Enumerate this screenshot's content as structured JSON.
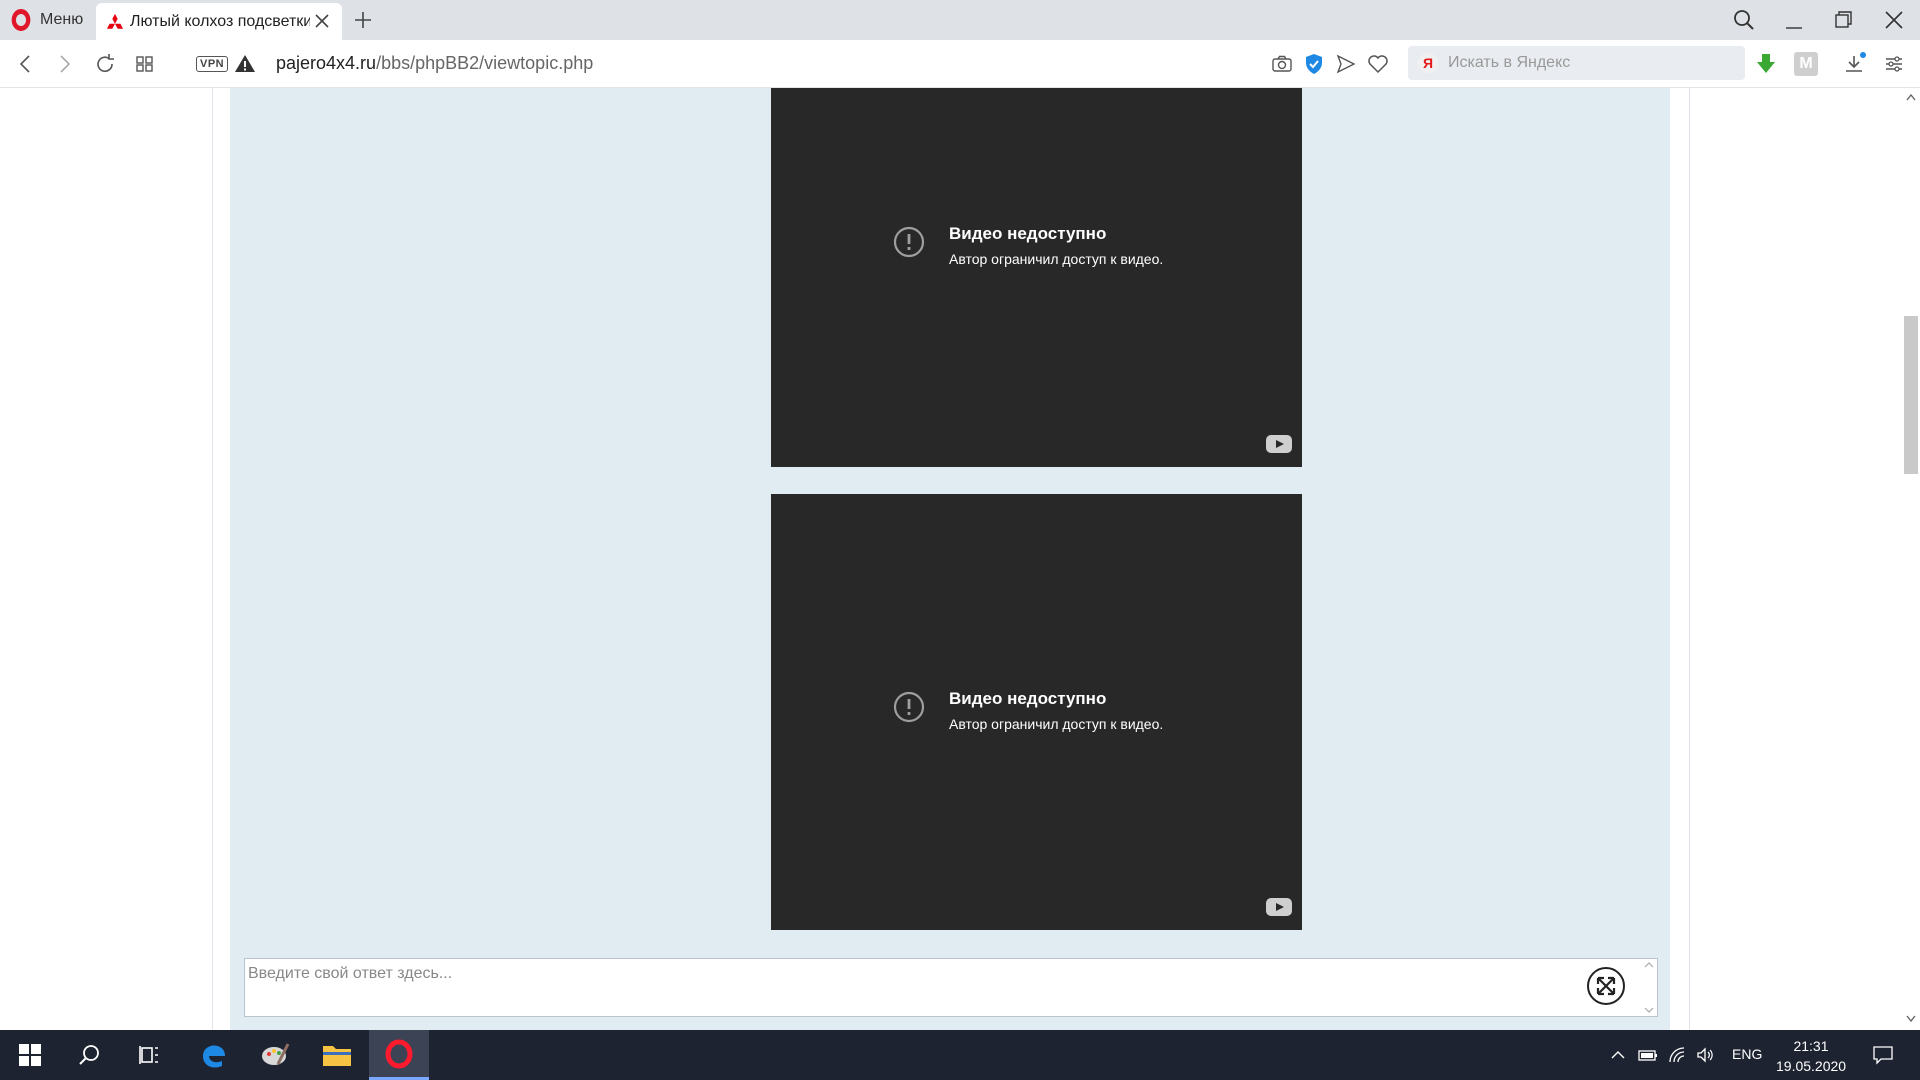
{
  "browser": {
    "menu_label": "Меню",
    "active_tab_title": "Лютый колхоз подсветки",
    "url_host": "pajero4x4.ru",
    "url_path": "/bbs/phpBB2/viewtopic.php",
    "vpn_label": "VPN",
    "search_placeholder": "Искать в Яндекс",
    "search_engine_glyph": "Я",
    "m_extension_label": "M"
  },
  "page": {
    "videos": [
      {
        "title": "Видео недоступно",
        "subtitle": "Автор ограничил доступ к видео."
      },
      {
        "title": "Видео недоступно",
        "subtitle": "Автор ограничил доступ к видео."
      }
    ],
    "reply_placeholder": "Введите свой ответ здесь..."
  },
  "taskbar": {
    "language": "ENG",
    "time": "21:31",
    "date": "19.05.2020"
  },
  "colors": {
    "post_background": "#e1ebf2",
    "video_background": "#282828",
    "opera_red": "#e0162b",
    "taskbar": "#1d2330"
  },
  "icons": [
    "opera-logo-icon",
    "mitsubishi-favicon-icon",
    "close-tab-icon",
    "new-tab-icon",
    "back-icon",
    "forward-icon",
    "reload-icon",
    "speed-dial-icon",
    "security-warning-icon",
    "camera-icon",
    "shield-check-icon",
    "send-icon",
    "heart-icon",
    "download-arrow-icon",
    "downloads-icon",
    "easy-setup-icon",
    "windows-start-icon",
    "search-icon",
    "task-view-icon",
    "edge-icon",
    "paint-icon",
    "file-explorer-icon",
    "opera-taskbar-icon"
  ]
}
